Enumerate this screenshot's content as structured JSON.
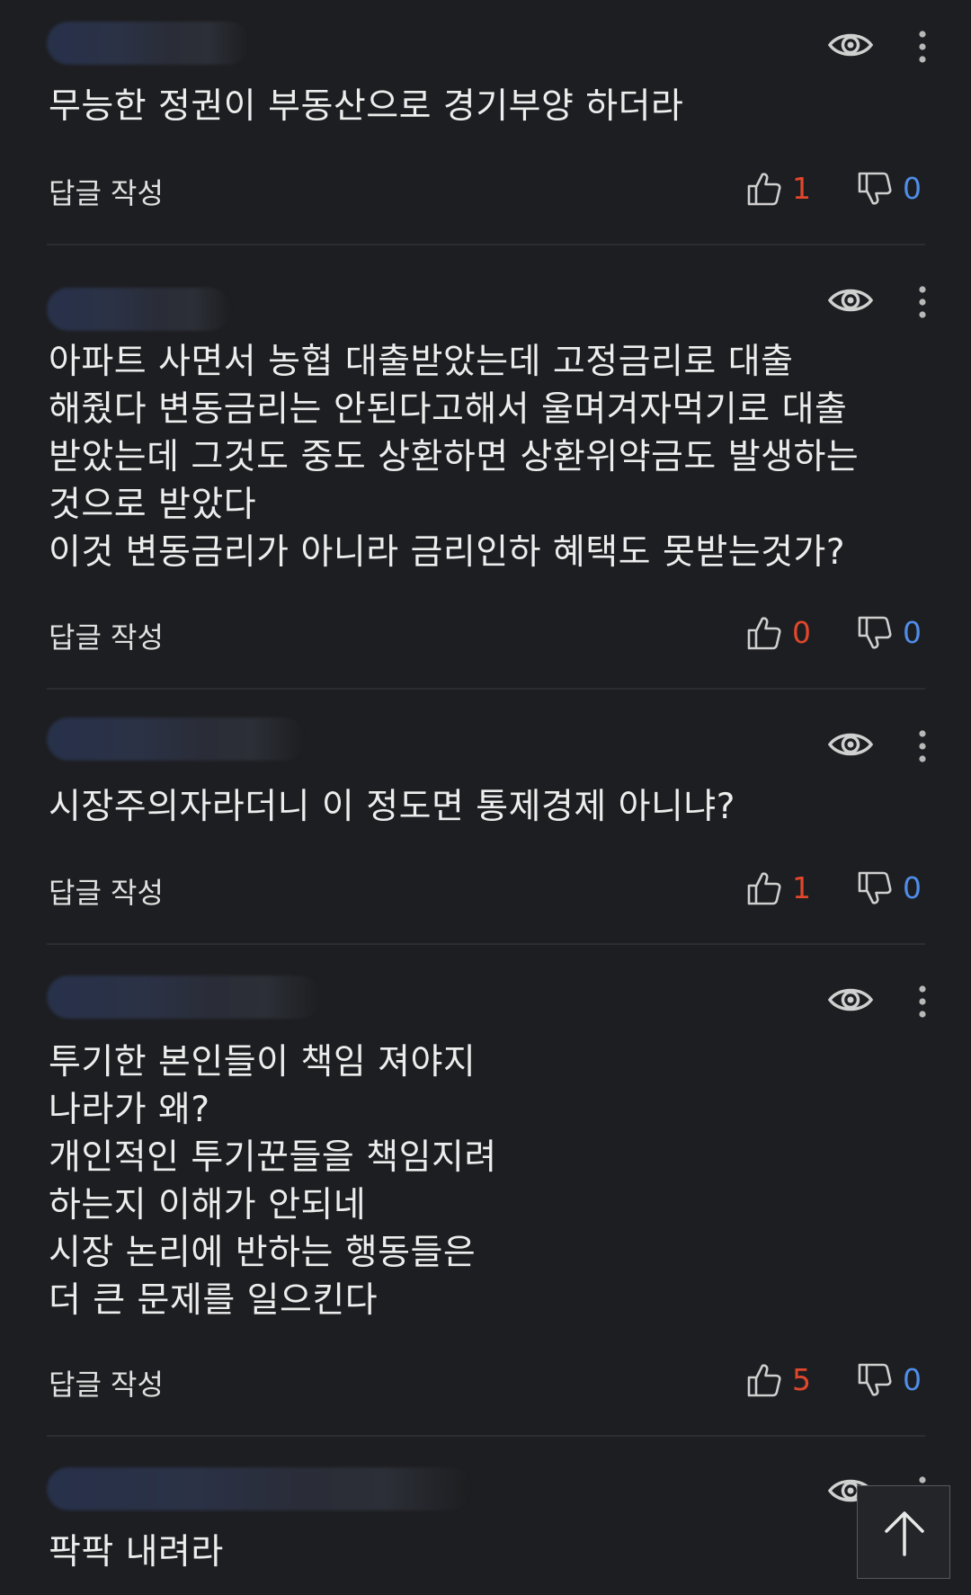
{
  "comments": [
    {
      "text": "무능한 정권이 부동산으로 경기부양 하더라",
      "reply_label": "답글 작성",
      "likes": "1",
      "dislikes": "0"
    },
    {
      "text": "아파트 사면서 농협 대출받았는데 고정금리로 대출\n해줬다 변동금리는 안된다고해서 울며겨자먹기로 대출\n받았는데 그것도 중도 상환하면 상환위약금도 발생하는\n것으로 받았다\n이것 변동금리가 아니라 금리인하 혜택도 못받는것가?",
      "reply_label": "답글 작성",
      "likes": "0",
      "dislikes": "0"
    },
    {
      "text": "시장주의자라더니 이 정도면 통제경제 아니냐?",
      "reply_label": "답글 작성",
      "likes": "1",
      "dislikes": "0"
    },
    {
      "text": "투기한 본인들이 책임 져야지\n나라가 왜?\n개인적인 투기꾼들을 책임지려\n하는지 이해가 안되네\n시장 논리에 반하는 행동들은\n더 큰 문제를 일으킨다",
      "reply_label": "답글 작성",
      "likes": "5",
      "dislikes": "0"
    },
    {
      "text": "팍팍 내려라"
    }
  ],
  "icons": {
    "view": "eye-icon",
    "more": "more-vertical-icon",
    "like": "thumbs-up-icon",
    "dislike": "thumbs-down-icon",
    "scroll_top": "arrow-up-icon"
  },
  "colors": {
    "background": "#1d1e21",
    "like": "#e2472c",
    "dislike": "#4f8de8"
  }
}
